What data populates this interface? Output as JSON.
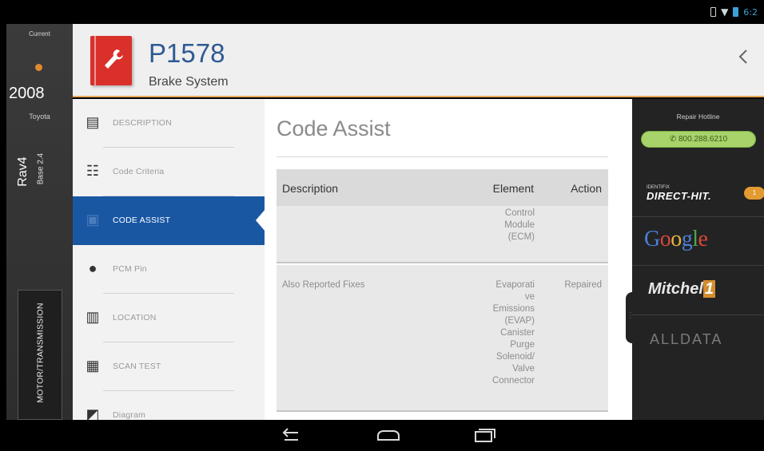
{
  "status_bar": {
    "time": "6:2"
  },
  "vehicle": {
    "current_label": "Current",
    "year": "2008",
    "make": "Toyota",
    "model": "Rav4",
    "engine": "Base 2.4",
    "category": "MOTOR/TRANSMISSION"
  },
  "header": {
    "code": "P1578",
    "system": "Brake System"
  },
  "nav": {
    "items": [
      {
        "label": "DESCRIPTION",
        "icon": "document-icon"
      },
      {
        "label": "Code Criteria",
        "icon": "list-icon"
      },
      {
        "label": "CODE ASSIST",
        "icon": "assist-icon"
      },
      {
        "label": "PCM Pin",
        "icon": "pin-icon"
      },
      {
        "label": "LOCATION",
        "icon": "map-icon"
      },
      {
        "label": "SCAN TEST",
        "icon": "clipboard-icon"
      },
      {
        "label": "Diagram",
        "icon": "diagram-icon"
      }
    ],
    "active_index": 2
  },
  "main": {
    "title": "Code Assist",
    "columns": {
      "description": "Description",
      "element": "Element",
      "action": "Action"
    },
    "rows": [
      {
        "description": "",
        "element": "Control\nModule\n(ECM)",
        "action": ""
      },
      {
        "description": "Also Reported Fixes",
        "element": "Evaporati\nve\nEmissions\n(EVAP)\nCanister\nPurge\nSolenoid/\nValve\nConnector",
        "action": "Repaired"
      }
    ]
  },
  "right_panel": {
    "hotline_label": "Repair Hotline",
    "hotline_number": "800.288.6210",
    "brands": {
      "identifix_sub": "IDENTIFIX",
      "identifix": "DIRECT-HIT.",
      "identifix_badge": "1",
      "google": "Google",
      "mitchell": "Mitchell",
      "mitchell_mark": "1",
      "alldata": "ALLDATA"
    }
  },
  "colors": {
    "accent_blue": "#1a57a3",
    "code_red": "#d9302a",
    "header_rule": "#e8a75c",
    "hotline_green": "#a7d36a"
  }
}
